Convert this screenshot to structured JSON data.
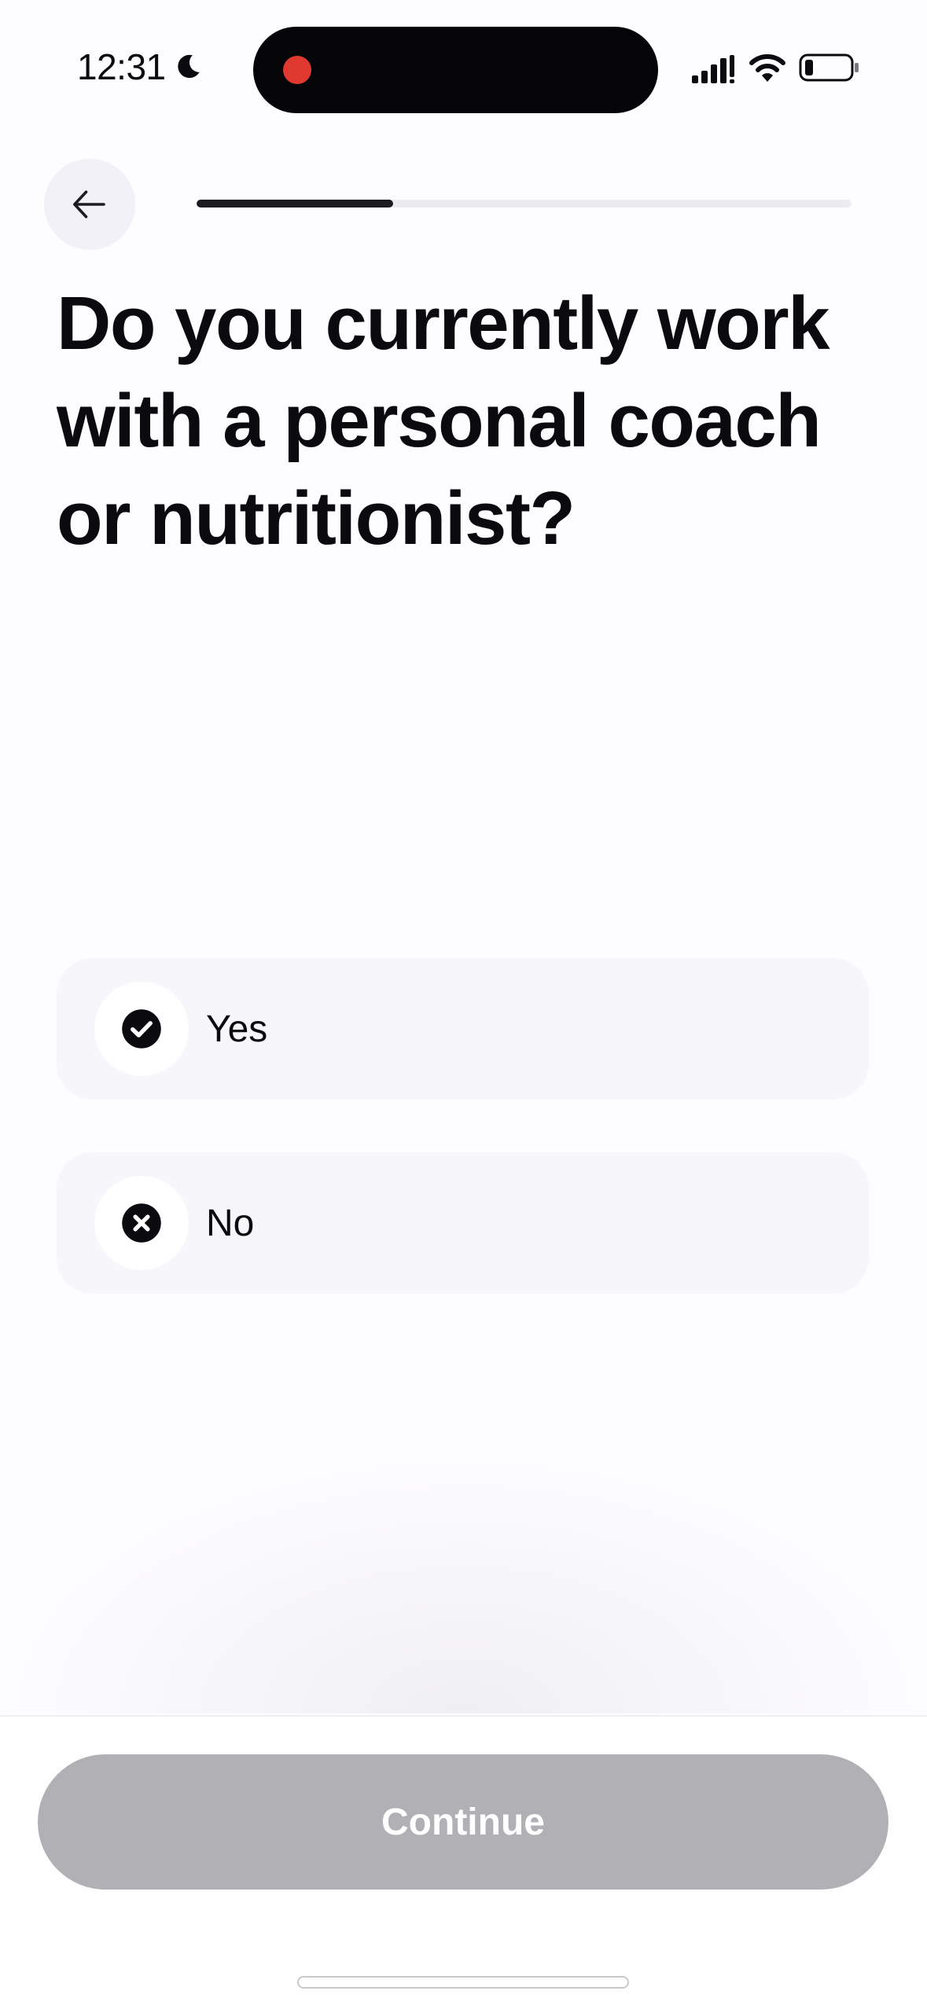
{
  "status_bar": {
    "time": "12:31",
    "icons": [
      "moon-icon",
      "signal-icon",
      "wifi-icon",
      "battery-icon"
    ],
    "recording_indicator_color": "#e0392f"
  },
  "header": {
    "back_icon": "arrow-left-icon",
    "progress": 0.3
  },
  "question": {
    "title": "Do you currently work with a personal coach or nutritionist?"
  },
  "options": [
    {
      "label": "Yes",
      "icon": "check-circle-icon"
    },
    {
      "label": "No",
      "icon": "x-circle-icon"
    }
  ],
  "footer": {
    "continue_label": "Continue",
    "continue_enabled": false,
    "continue_color": "#b1b0b5"
  }
}
